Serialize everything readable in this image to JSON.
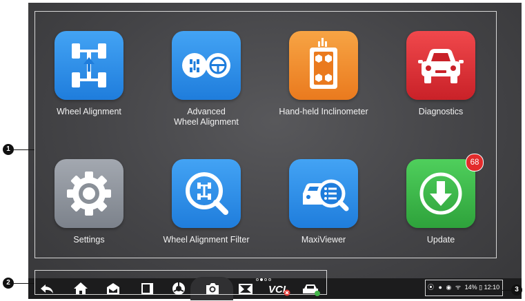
{
  "apps": [
    {
      "id": "wheel-alignment",
      "label": [
        "Wheel Alignment"
      ],
      "color": "#2f8fe8",
      "icon": "wheel-alignment-icon"
    },
    {
      "id": "advanced-wheel-alignment",
      "label": [
        "Advanced",
        "Wheel Alignment"
      ],
      "color": "#2f8fe8",
      "icon": "advanced-wheel-alignment-icon"
    },
    {
      "id": "hand-held-inclinometer",
      "label": [
        "Hand-held Inclinometer"
      ],
      "color": "#f08c2c",
      "icon": "inclinometer-icon"
    },
    {
      "id": "diagnostics",
      "label": [
        "Diagnostics"
      ],
      "color": "#e0353b",
      "icon": "car-icon"
    },
    {
      "id": "settings",
      "label": [
        "Settings"
      ],
      "color": "#8c929c",
      "icon": "gear-icon"
    },
    {
      "id": "wheel-alignment-filter",
      "label": [
        "Wheel Alignment Filter"
      ],
      "color": "#2f8fe8",
      "icon": "alignment-filter-icon"
    },
    {
      "id": "maxiviewer",
      "label": [
        "MaxiViewer"
      ],
      "color": "#2f8fe8",
      "icon": "maxiviewer-icon"
    },
    {
      "id": "update",
      "label": [
        "Update"
      ],
      "color": "#3cbb4a",
      "icon": "download-icon",
      "badge": "68"
    }
  ],
  "navbar": {
    "items": [
      "back-icon",
      "home-icon",
      "vci-manager-icon",
      "recent-apps-icon",
      "browser-icon",
      "camera-icon",
      "screen-capture-icon",
      "vci-icon",
      "vehicle-status-icon"
    ],
    "pager": {
      "count": 4,
      "active": 1
    }
  },
  "status_bar": {
    "battery": "14%",
    "time": "12:10"
  },
  "callouts": {
    "one": "1",
    "two": "2",
    "three": "3"
  }
}
